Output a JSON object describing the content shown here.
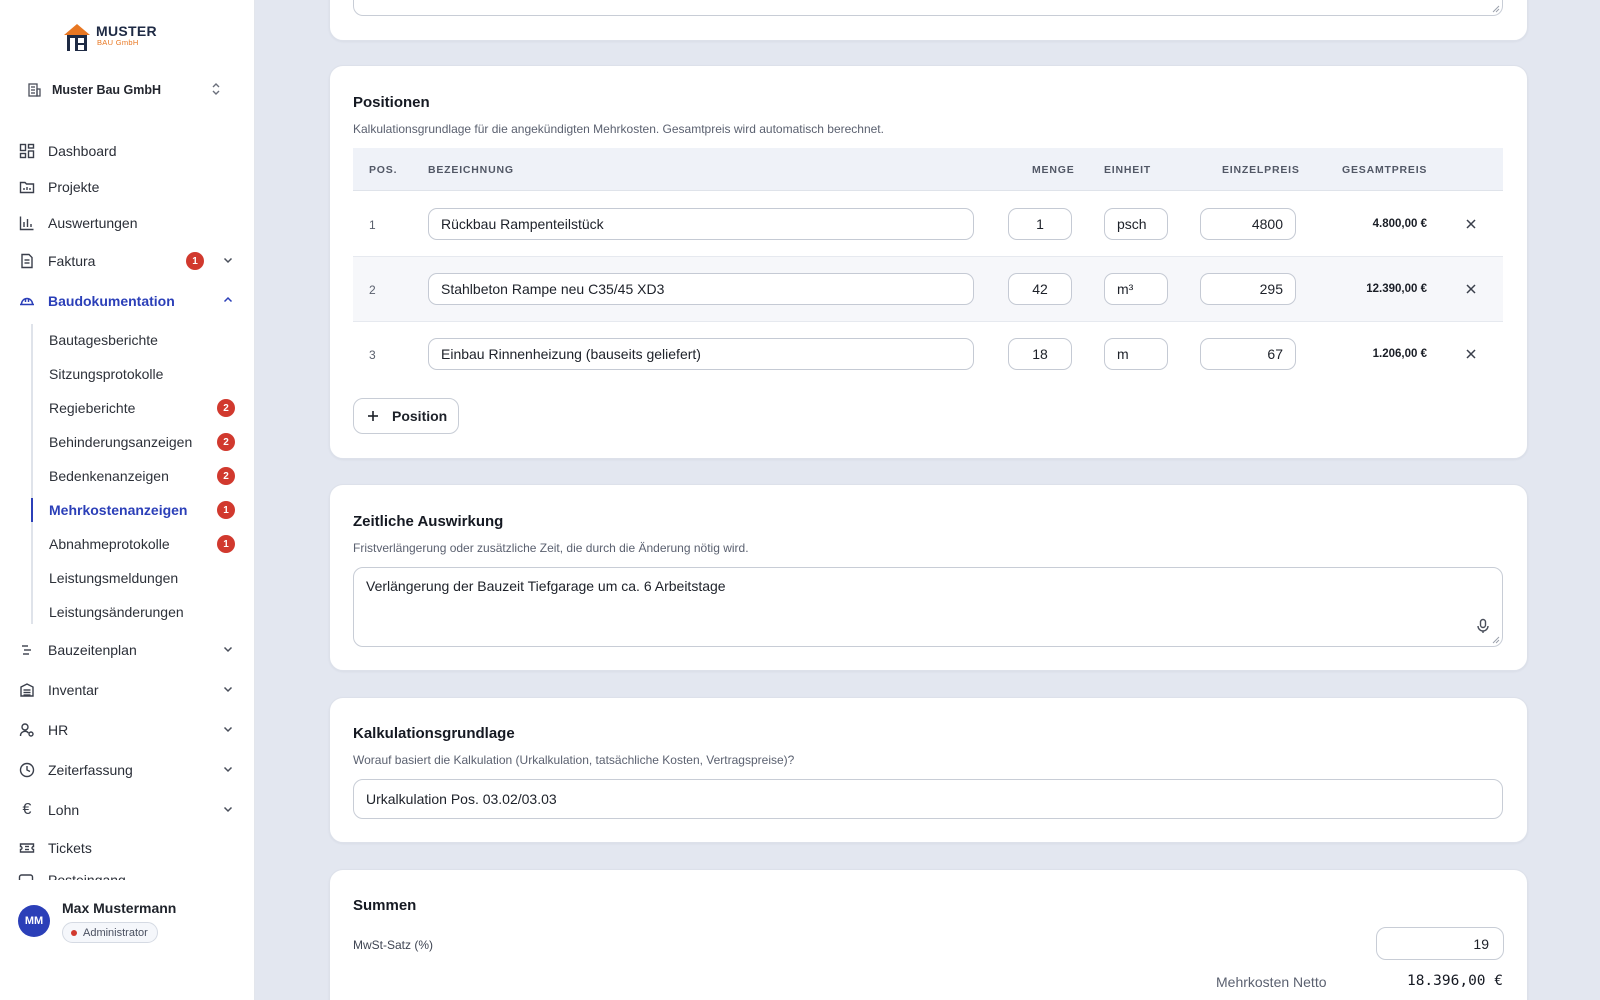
{
  "brand": {
    "name": "MUSTER",
    "sub": "BAU GmbH"
  },
  "company_select": {
    "value": "Muster Bau GmbH"
  },
  "nav": [
    {
      "label": "Dashboard",
      "icon": "dashboard-icon"
    },
    {
      "label": "Projekte",
      "icon": "folder-icon"
    },
    {
      "label": "Auswertungen",
      "icon": "bar-chart-icon"
    },
    {
      "label": "Faktura",
      "icon": "document-icon",
      "badge": "1"
    },
    {
      "label": "Baudokumentation",
      "icon": "hardhat-icon"
    },
    {
      "label": "Bauzeitenplan",
      "icon": "timeline-icon"
    },
    {
      "label": "Inventar",
      "icon": "inventory-icon"
    },
    {
      "label": "HR",
      "icon": "user-cog-icon"
    },
    {
      "label": "Zeiterfassung",
      "icon": "clock-icon"
    },
    {
      "label": "Lohn",
      "icon": "euro-icon"
    },
    {
      "label": "Tickets",
      "icon": "ticket-icon"
    },
    {
      "label": "Posteingang",
      "icon": "inbox-icon"
    }
  ],
  "subnav": [
    {
      "label": "Bautagesberichte"
    },
    {
      "label": "Sitzungsprotokolle"
    },
    {
      "label": "Regieberichte",
      "badge": "2"
    },
    {
      "label": "Behinderungsanzeigen",
      "badge": "2"
    },
    {
      "label": "Bedenkenanzeigen",
      "badge": "2"
    },
    {
      "label": "Mehrkostenanzeigen",
      "badge": "1"
    },
    {
      "label": "Abnahmeprotokolle",
      "badge": "1"
    },
    {
      "label": "Leistungsmeldungen"
    },
    {
      "label": "Leistungsänderungen"
    }
  ],
  "user": {
    "initials": "MM",
    "name": "Max Mustermann",
    "role": "Administrator"
  },
  "positionen": {
    "title": "Positionen",
    "description": "Kalkulationsgrundlage für die angekündigten Mehrkosten. Gesamtpreis wird automatisch berechnet.",
    "headers": {
      "pos": "POS.",
      "bezeichnung": "BEZEICHNUNG",
      "menge": "MENGE",
      "einheit": "EINHEIT",
      "einzelpreis": "EINZELPREIS",
      "gesamtpreis": "GESAMTPREIS"
    },
    "rows": [
      {
        "pos": "1",
        "bezeichnung": "Rückbau Rampenteilstück",
        "menge": "1",
        "einheit": "psch",
        "einzelpreis": "4800",
        "gesamtpreis": "4.800,00 €"
      },
      {
        "pos": "2",
        "bezeichnung": "Stahlbeton Rampe neu C35/45 XD3",
        "menge": "42",
        "einheit": "m³",
        "einzelpreis": "295",
        "gesamtpreis": "12.390,00 €"
      },
      {
        "pos": "3",
        "bezeichnung": "Einbau Rinnenheizung (bauseits geliefert)",
        "menge": "18",
        "einheit": "m",
        "einzelpreis": "67",
        "gesamtpreis": "1.206,00 €"
      }
    ],
    "add_label": "Position"
  },
  "zeitliche": {
    "title": "Zeitliche Auswirkung",
    "description": "Fristverlängerung oder zusätzliche Zeit, die durch die Änderung nötig wird.",
    "value": "Verlängerung der Bauzeit Tiefgarage um ca. 6 Arbeitstage"
  },
  "kalkulation": {
    "title": "Kalkulationsgrundlage",
    "description": "Worauf basiert die Kalkulation (Urkalkulation, tatsächliche Kosten, Vertragspreise)?",
    "value": "Urkalkulation Pos. 03.02/03.03"
  },
  "summen": {
    "title": "Summen",
    "mwst_label": "MwSt-Satz (%)",
    "mwst_value": "19",
    "netto_label": "Mehrkosten Netto",
    "netto_value": "18.396,00 €"
  },
  "colors": {
    "accent": "#2b3fb8",
    "badge": "#d1392e",
    "background": "#e3e7f0"
  }
}
